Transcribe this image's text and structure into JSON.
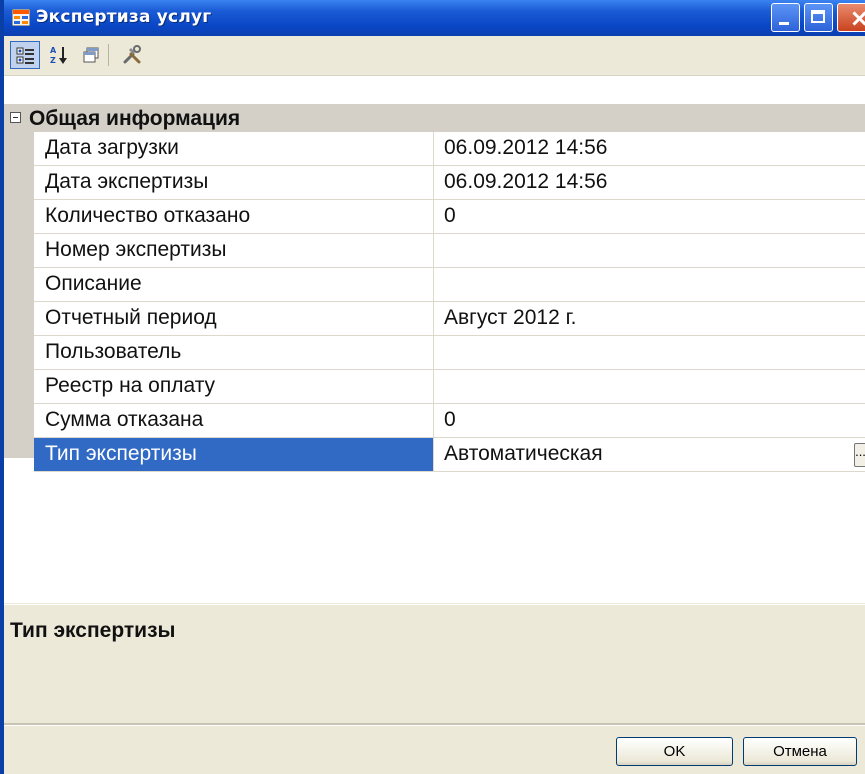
{
  "window": {
    "title": "Экспертиза услуг"
  },
  "toolbar": {
    "buttons": [
      {
        "name": "categorized-view-icon",
        "pressed": true
      },
      {
        "name": "alphabetical-sort-icon",
        "pressed": false
      },
      {
        "name": "property-pages-icon",
        "pressed": false
      },
      {
        "name": "properties-icon",
        "pressed": false
      }
    ]
  },
  "grid": {
    "category": {
      "label": "Общая информация",
      "expanded": true,
      "toggle": "⊟"
    },
    "properties": [
      {
        "name": "Дата загрузки",
        "value": "06.09.2012 14:56"
      },
      {
        "name": "Дата экспертизы",
        "value": "06.09.2012 14:56"
      },
      {
        "name": "Количество отказано",
        "value": "0"
      },
      {
        "name": "Номер экспертизы",
        "value": ""
      },
      {
        "name": "Описание",
        "value": ""
      },
      {
        "name": "Отчетный период",
        "value": "Август 2012 г."
      },
      {
        "name": "Пользователь",
        "value": ""
      },
      {
        "name": "Реестр на оплату",
        "value": ""
      },
      {
        "name": "Сумма отказана",
        "value": "0"
      },
      {
        "name": "Тип экспертизы",
        "value": "Автоматическая",
        "selected": true,
        "ellipsis": "..."
      }
    ]
  },
  "description": {
    "title": "Тип экспертизы"
  },
  "buttons": {
    "ok_label": "OK",
    "cancel_label": "Отмена"
  },
  "colors": {
    "titlebar": "#0a47c7",
    "selection": "#316ac5",
    "dialog_bg": "#ece9d8",
    "margin": "#d4d0c8"
  }
}
